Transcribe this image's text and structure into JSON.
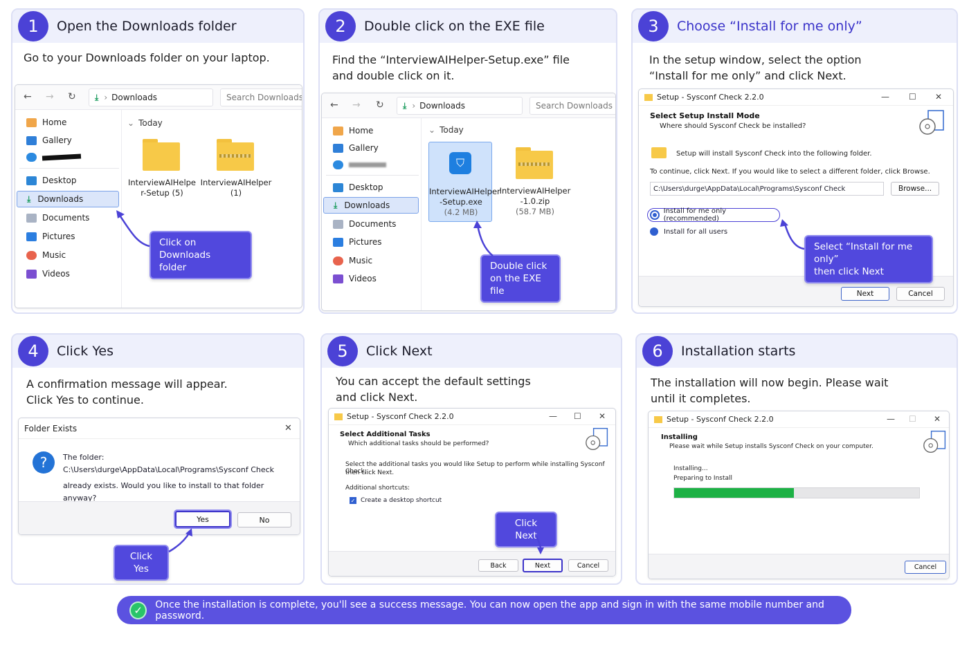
{
  "steps": [
    {
      "num": "1",
      "title": "Open the Downloads folder",
      "desc": "Go to your Downloads folder on your laptop."
    },
    {
      "num": "2",
      "title": "Double click on the EXE file",
      "desc1": "Find the “InterviewAIHelper-Setup.exe” file",
      "desc2": "and double click on it."
    },
    {
      "num": "3",
      "title": "Choose “Install for me only”",
      "desc1": "In the setup window, select the option",
      "desc2": "“Install for me only” and click Next."
    },
    {
      "num": "4",
      "title": "Click Yes",
      "desc1": "A confirmation message will appear.",
      "desc2": "Click Yes to continue."
    },
    {
      "num": "5",
      "title": "Click Next",
      "desc1": "You can accept the default settings",
      "desc2": "and click Next."
    },
    {
      "num": "6",
      "title": "Installation starts",
      "desc1": "The installation will now begin. Please wait",
      "desc2": "until it completes."
    }
  ],
  "explorer": {
    "address": "Downloads",
    "search_placeholder": "Search Downloads",
    "sidebar": [
      "Home",
      "Gallery",
      "Desktop",
      "Downloads",
      "Documents",
      "Pictures",
      "Music",
      "Videos"
    ],
    "group": "Today",
    "files1": [
      {
        "line1": "InterviewAIHelpe",
        "line2": "r-Setup (5)",
        "line3": ""
      },
      {
        "line1": "InterviewAIHelper",
        "line2": "(1)",
        "line3": ""
      }
    ],
    "files2": [
      {
        "line1": "InterviewAIHelper",
        "line2": "-Setup.exe",
        "line3": "(4.2 MB)"
      },
      {
        "line1": "InterviewAIHelper",
        "line2": "-1.0.zip",
        "line3": "(58.7 MB)"
      }
    ]
  },
  "callouts": {
    "c1a": "Click on Downloads",
    "c1b": "folder",
    "c2a": "Double click",
    "c2b": "on the EXE file",
    "c3a": "Select “Install for me only”",
    "c3b": "then click Next",
    "c4": "Click Yes",
    "c5": "Click Next"
  },
  "setup3": {
    "title": "Setup - Sysconf Check 2.2.0",
    "heading": "Select Setup Install Mode",
    "sub": "Where should Sysconf Check be installed?",
    "line1": "Setup will install Sysconf Check into the following folder.",
    "line2": "To continue, click Next. If you would like to select a different folder, click Browse.",
    "path": "C:\\Users\\durge\\AppData\\Local\\Programs\\Sysconf Check",
    "browse": "Browse...",
    "opt1": "Install for me only (recommended)",
    "opt2": "Install for all users",
    "next": "Next",
    "cancel": "Cancel"
  },
  "dialog4": {
    "title": "Folder Exists",
    "line1": "The folder:",
    "line2": "C:\\Users\\durge\\AppData\\Local\\Programs\\Sysconf Check",
    "line3": "already exists. Would you like to install to that folder anyway?",
    "yes": "Yes",
    "no": "No"
  },
  "setup5": {
    "title": "Setup - Sysconf Check 2.2.0",
    "heading": "Select Additional Tasks",
    "sub": "Which additional tasks should be performed?",
    "line1": "Select the additional tasks you would like Setup to perform while installing Sysconf Check,",
    "line2": "then click Next.",
    "shortcuts": "Additional shortcuts:",
    "checkbox": "Create a desktop shortcut",
    "back": "Back",
    "next": "Next",
    "cancel": "Cancel"
  },
  "setup6": {
    "title": "Setup - Sysconf Check 2.2.0",
    "heading": "Installing",
    "sub": "Please wait while Setup installs Sysconf Check on your computer.",
    "status1": "Installing...",
    "status2": "Preparing to Install",
    "progress": 0.49,
    "cancel": "Cancel"
  },
  "banner": "Once the installation is complete, you'll see a success message. You can now open the app and sign in with the same mobile number and password.",
  "colors": {
    "accent": "#4b42d6",
    "callout": "#5148dd",
    "progress": "#1db145",
    "success": "#29c46a"
  }
}
